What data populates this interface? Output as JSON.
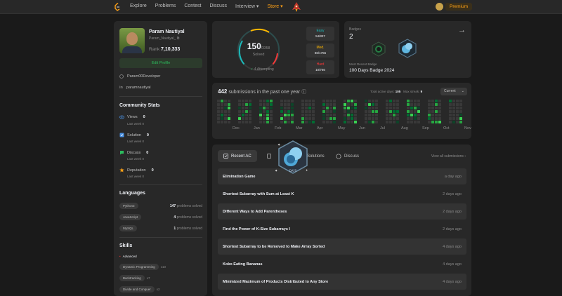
{
  "nav": {
    "items": [
      "Explore",
      "Problems",
      "Contest",
      "Discuss",
      "Interview",
      "Store"
    ],
    "notifications_count": "0",
    "premium": "Premium"
  },
  "profile": {
    "name": "Param Nautiyal",
    "username": "Param_Nautiyal_",
    "rank_label": "Rank",
    "rank": "7,10,333",
    "edit": "Edit Profile",
    "github": "Param00Developer",
    "linkedin": "paramnautiyal"
  },
  "community": {
    "title": "Community Stats",
    "items": [
      {
        "label": "Views",
        "value": "0",
        "sub": "Last week 0"
      },
      {
        "label": "Solution",
        "value": "0",
        "sub": "Last week 0"
      },
      {
        "label": "Discuss",
        "value": "0",
        "sub": "Last week 0"
      },
      {
        "label": "Reputation",
        "value": "0",
        "sub": "Last week 0"
      }
    ]
  },
  "languages": {
    "title": "Languages",
    "items": [
      {
        "name": "Python3",
        "count": "147",
        "suffix": "problems solved"
      },
      {
        "name": "JavaScript",
        "count": "4",
        "suffix": "problems solved"
      },
      {
        "name": "MySQL",
        "count": "1",
        "suffix": "problems solved"
      }
    ]
  },
  "skills": {
    "title": "Skills",
    "level": "Advanced",
    "items": [
      {
        "name": "Dynamic Programming",
        "count": "x10"
      },
      {
        "name": "Backtracking",
        "count": "x7"
      },
      {
        "name": "Divide and Conquer",
        "count": "x2"
      }
    ]
  },
  "solved": {
    "count": "150",
    "total": "/3358",
    "label": "Solved",
    "attempting": "4 Attempting",
    "progress": 0.0447,
    "difficulties": [
      {
        "label": "Easy",
        "value": "54/837",
        "color": "#1cbaba"
      },
      {
        "label": "Med.",
        "value": "86/1755",
        "color": "#ffb700"
      },
      {
        "label": "Hard",
        "value": "10/766",
        "color": "#f63737"
      }
    ]
  },
  "badges": {
    "title": "Badges",
    "count": "2",
    "recent_label": "Most Recent Badge",
    "recent": "100 Days Badge 2024"
  },
  "heatmap": {
    "count": "442",
    "title": "submissions in the past one year",
    "active_label": "Total active days:",
    "active": "105",
    "streak_label": "Max streak:",
    "streak": "9",
    "period": "Current",
    "months": [
      "Dec",
      "Jan",
      "Feb",
      "Mar",
      "Apr",
      "May",
      "Jun",
      "Jul",
      "Aug",
      "Sep",
      "Oct",
      "Nov"
    ]
  },
  "recent": {
    "tabs": [
      "Recent AC",
      "List",
      "Solutions",
      "Discuss"
    ],
    "view_all": "View all submissions",
    "items": [
      {
        "title": "Elimination Game",
        "when": "a day ago"
      },
      {
        "title": "Shortest Subarray with Sum at Least K",
        "when": "2 days ago"
      },
      {
        "title": "Different Ways to Add Parentheses",
        "when": "2 days ago"
      },
      {
        "title": "Find the Power of K-Size Subarrays I",
        "when": "2 days ago"
      },
      {
        "title": "Shortest Subarray to be Removed to Make Array Sorted",
        "when": "4 days ago"
      },
      {
        "title": "Koko Eating Bananas",
        "when": "4 days ago"
      },
      {
        "title": "Minimized Maximum of Products Distributed to Any Store",
        "when": "4 days ago"
      }
    ]
  },
  "popup": {
    "label": "DAYS"
  }
}
